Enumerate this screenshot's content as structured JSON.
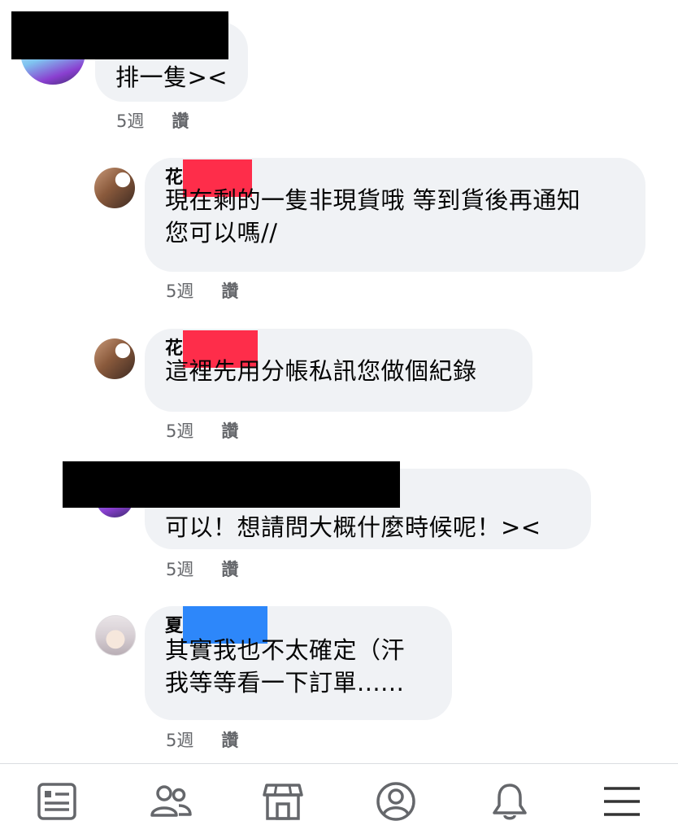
{
  "comments": [
    {
      "author": "",
      "text_lines": [
        "排一隻><"
      ],
      "time": "5週",
      "like": "讚"
    },
    {
      "author": "花",
      "text_lines": [
        "現在剩的一隻非現貨哦 等到貨後再通知",
        "您可以嗎//"
      ],
      "time": "5週",
      "like": "讚"
    },
    {
      "author": "花",
      "text_lines": [
        "這裡先用分帳私訊您做個紀錄"
      ],
      "time": "5週",
      "like": "讚"
    },
    {
      "author": "",
      "text_lines": [
        "可以！想請問大概什麼時候呢！><"
      ],
      "time": "5週",
      "like": "讚"
    },
    {
      "author": "夏",
      "text_lines": [
        "其實我也不太確定（汗",
        "我等等看一下訂單......"
      ],
      "time": "5週",
      "like": "讚"
    }
  ],
  "colors": {
    "bubble": "#f0f2f5",
    "redact_red": "#fe2d4a",
    "redact_blue": "#2d87fa",
    "meta_text": "#65676b",
    "icon": "#65676b"
  },
  "nav": [
    {
      "icon": "news-feed-icon"
    },
    {
      "icon": "friends-icon"
    },
    {
      "icon": "marketplace-icon"
    },
    {
      "icon": "profile-icon"
    },
    {
      "icon": "notifications-bell-icon"
    },
    {
      "icon": "menu-icon"
    }
  ]
}
